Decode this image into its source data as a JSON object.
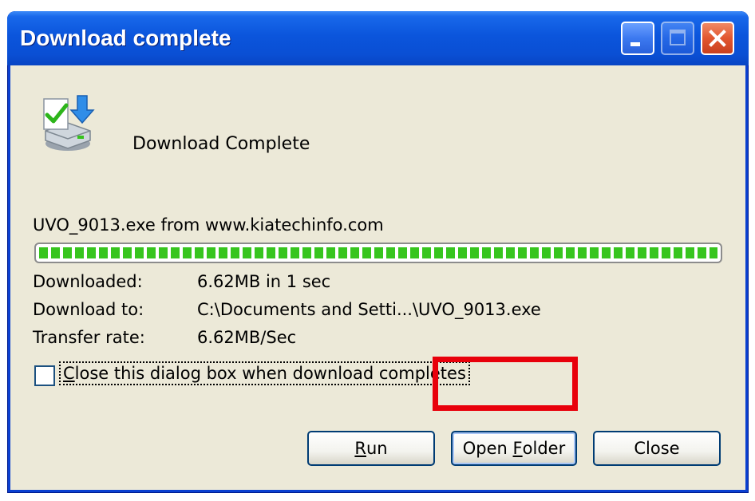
{
  "window": {
    "title": "Download complete"
  },
  "header": {
    "message": "Download Complete",
    "icon": "download-complete-icon"
  },
  "download": {
    "source": "UVO_9013.exe from www.kiatechinfo.com",
    "progress_fraction": 1.0,
    "details": [
      {
        "label": "Downloaded:",
        "value": "6.62MB in 1 sec"
      },
      {
        "label": "Download to:",
        "value": "C:\\Documents and Setti...\\UVO_9013.exe"
      },
      {
        "label": "Transfer rate:",
        "value": "6.62MB/Sec"
      }
    ]
  },
  "option": {
    "close_when_done": {
      "first": "C",
      "rest": "lose this dialog box when download completes",
      "checked": false
    }
  },
  "buttons": {
    "run": {
      "accel": "R",
      "rest": "un"
    },
    "open_folder": {
      "pre": "Open ",
      "accel": "F",
      "rest": "older"
    },
    "close": {
      "label": "Close"
    }
  },
  "colors": {
    "title_bar": "#0a55dc",
    "client_bg": "#ece9d8",
    "progress": "#37c51e",
    "highlight": "#e8000b"
  }
}
